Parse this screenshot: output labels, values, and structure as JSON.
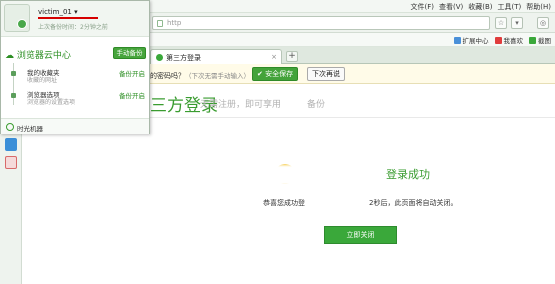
{
  "menu": [
    "文件(F)",
    "查看(V)",
    "收藏(B)",
    "工具(T)",
    "帮助(H)"
  ],
  "address": {
    "value": "http"
  },
  "favorites_bar": {
    "items": [
      "扩展中心",
      "我喜欢",
      "截图"
    ]
  },
  "tab": {
    "title": "第三方登录",
    "close": "×",
    "new_tab": "+"
  },
  "password_bar": {
    "question": "的密码吗？",
    "hint": "（下次无需手动输入）",
    "save_label": "安全保存",
    "later_label": "下次再说"
  },
  "cloud_panel": {
    "username": "victim_01",
    "last_backup": "上次备份时间：2分钟之前",
    "title": "浏览器云中心",
    "manual_backup": "手动备份",
    "favorites": {
      "label": "我的收藏夹",
      "sub": "收藏的网址",
      "status": "备份开启"
    },
    "settings": {
      "label": "浏览器选项",
      "sub": "浏览器的设置选项",
      "status": "备份开启"
    },
    "time_machine": "时光机器"
  },
  "page": {
    "title": "三方登录",
    "subtitle": "无需注册，即可享用",
    "subtitle_tail": "备份",
    "success": "登录成功",
    "msg_left": "恭喜您成功登",
    "msg_right": "2秒后，此页面将自动关闭。",
    "close_button": "立即关闭"
  },
  "colors": {
    "brand_green": "#3a9c30",
    "accent_red": "#d60000"
  },
  "icons": [
    "gear-icon",
    "cloud-icon",
    "clock-icon",
    "user-icon",
    "shield-icon"
  ]
}
